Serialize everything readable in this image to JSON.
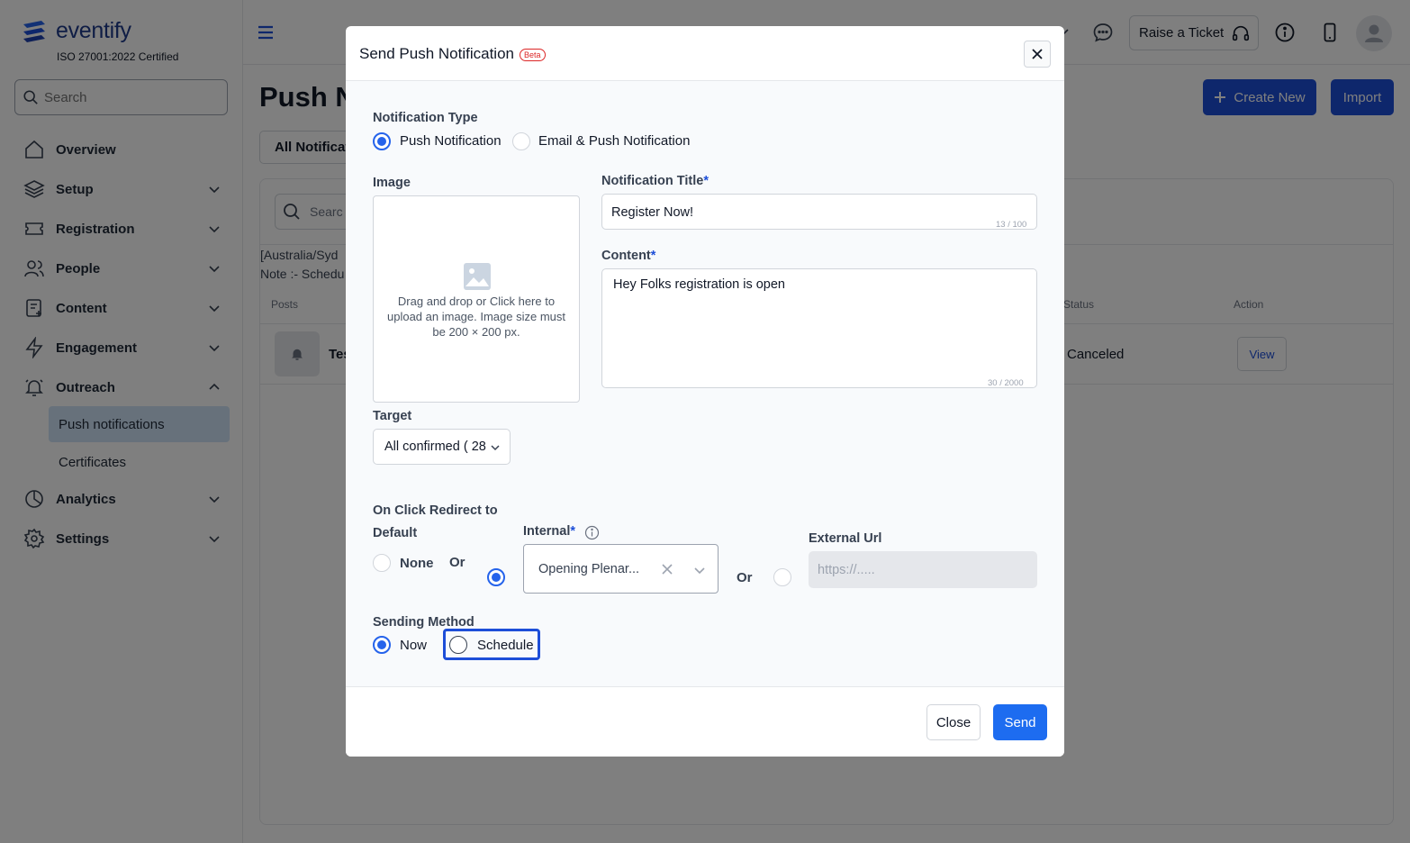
{
  "sidebar": {
    "logo_text": "eventify",
    "certification": "ISO 27001:2022 Certified",
    "search_placeholder": "Search",
    "items": [
      {
        "label": "Overview",
        "icon": "home-icon"
      },
      {
        "label": "Setup",
        "icon": "layers-icon"
      },
      {
        "label": "Registration",
        "icon": "ticket-icon"
      },
      {
        "label": "People",
        "icon": "people-icon"
      },
      {
        "label": "Content",
        "icon": "content-icon"
      },
      {
        "label": "Engagement",
        "icon": "bolt-icon"
      },
      {
        "label": "Outreach",
        "icon": "bell-icon"
      }
    ],
    "outreach_sub": [
      "Push notifications",
      "Certificates"
    ],
    "bottom_items": [
      {
        "label": "Analytics",
        "icon": "pie-chart-icon"
      },
      {
        "label": "Settings",
        "icon": "gear-icon"
      }
    ]
  },
  "topbar": {
    "raise_ticket": "Raise a Ticket"
  },
  "main": {
    "page_title": "Push N",
    "create_new": "Create New",
    "import": "Import",
    "tab_all": "All Notificat",
    "search_placeholder": "Searc",
    "tz_line": "[Australia/Syd",
    "note_line": "Note :- Schedu",
    "col_posts": "Posts",
    "col_status": "Status",
    "col_action": "Action",
    "row_title": "Tes",
    "row_status": "Canceled",
    "row_action": "View"
  },
  "modal": {
    "title": "Send Push Notification",
    "badge": "Beta",
    "notification_type_label": "Notification Type",
    "type_options": [
      "Push Notification",
      "Email & Push Notification"
    ],
    "type_selected": "Push Notification",
    "image_label": "Image",
    "image_hint": "Drag and drop or Click here to upload an image. Image size must be 200 × 200 px.",
    "title_label": "Notification Title",
    "title_value": "Register Now!",
    "title_counter": "13 / 100",
    "content_label": "Content",
    "content_value": "Hey Folks registration is open",
    "content_counter": "30 / 2000",
    "target_label": "Target",
    "target_value": "All confirmed ( 28",
    "redirect_label": "On Click Redirect to",
    "default_label": "Default",
    "none_label": "None",
    "or_label": "Or",
    "internal_label": "Internal",
    "internal_value": "Opening Plenar...",
    "external_label": "External Url",
    "external_placeholder": "https://.....",
    "sending_method_label": "Sending Method",
    "method_options": [
      "Now",
      "Schedule"
    ],
    "method_selected": "Now",
    "close_button": "Close",
    "send_button": "Send"
  },
  "colors": {
    "primary": "#1d4ed8",
    "send": "#1d6cf0",
    "active_nav": "#cfe3f7",
    "beta": "#dc2626"
  }
}
